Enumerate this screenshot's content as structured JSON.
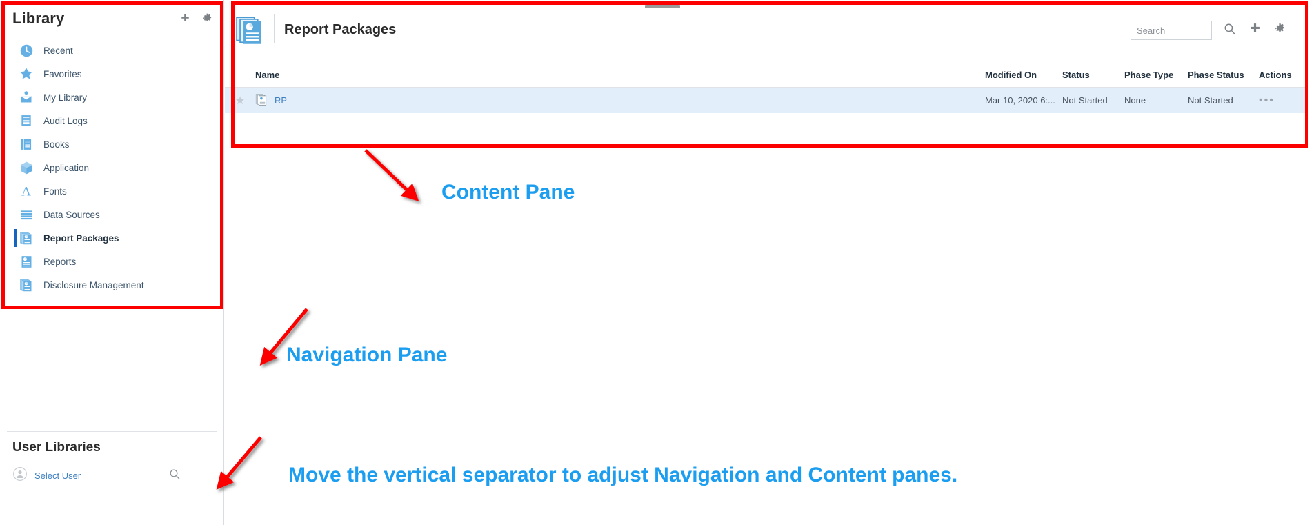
{
  "navigation": {
    "title": "Library",
    "add_icon": "plus-icon",
    "settings_icon": "gear-icon",
    "items": [
      {
        "label": "Recent",
        "icon": "clock-icon",
        "selected": false
      },
      {
        "label": "Favorites",
        "icon": "star-icon",
        "selected": false
      },
      {
        "label": "My Library",
        "icon": "user-folder-icon",
        "selected": false
      },
      {
        "label": "Audit Logs",
        "icon": "document-icon",
        "selected": false
      },
      {
        "label": "Books",
        "icon": "book-icon",
        "selected": false
      },
      {
        "label": "Application",
        "icon": "cube-icon",
        "selected": false
      },
      {
        "label": "Fonts",
        "icon": "letter-a-icon",
        "selected": false
      },
      {
        "label": "Data Sources",
        "icon": "stack-icon",
        "selected": false
      },
      {
        "label": "Report Packages",
        "icon": "report-package-icon",
        "selected": true
      },
      {
        "label": "Reports",
        "icon": "report-icon",
        "selected": false
      },
      {
        "label": "Disclosure Management",
        "icon": "disclosure-icon",
        "selected": false
      }
    ],
    "user_libraries": {
      "title": "User Libraries",
      "select_user_label": "Select User",
      "avatar_icon": "user-avatar-icon",
      "search_icon": "search-icon"
    }
  },
  "content": {
    "title": "Report Packages",
    "title_icon": "report-package-icon",
    "drag_handle": "pane-drag-handle",
    "toolbar": {
      "search_placeholder": "Search",
      "search_value": "",
      "search_icon": "search-icon",
      "add_icon": "plus-icon",
      "settings_icon": "gear-icon"
    },
    "table": {
      "columns": [
        "",
        "Name",
        "Modified On",
        "Status",
        "Phase Type",
        "Phase Status",
        "Actions"
      ],
      "rows": [
        {
          "favorite_icon": "star-outline-icon",
          "row_icon": "report-package-icon",
          "name": "RP",
          "modified_on": "Mar 10, 2020 6:...",
          "status": "Not Started",
          "phase_type": "None",
          "phase_status": "Not Started",
          "actions": "•••",
          "selected": true
        }
      ]
    }
  },
  "annotations": {
    "box_navigation": "Navigation Pane",
    "box_content": "Content Pane",
    "label_content_pane": "Content Pane",
    "label_navigation_pane": "Navigation Pane",
    "label_move_separator": "Move the vertical separator to adjust Navigation and Content panes.",
    "highlight_color": "#fc0000",
    "label_color": "#1b9df0"
  }
}
